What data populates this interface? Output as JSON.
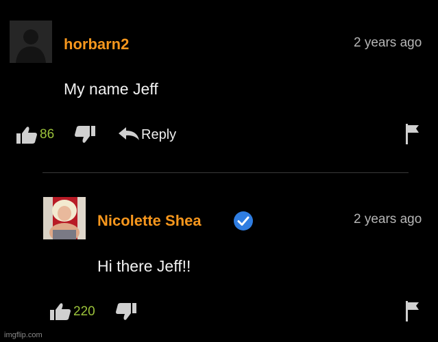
{
  "comments": [
    {
      "username": "horbarn2",
      "timestamp": "2 years ago",
      "text": "My name Jeff",
      "likes": "86",
      "reply_label": "Reply"
    },
    {
      "username": "Nicolette Shea",
      "verified": true,
      "timestamp": "2 years ago",
      "text": "Hi there Jeff!!",
      "likes": "220"
    }
  ],
  "watermark": "imgflip.com",
  "colors": {
    "background": "#000000",
    "username": "#f7971d",
    "likes": "#9cc33b",
    "timestamp": "#b7b7b7",
    "verified_badge": "#2f7de1"
  },
  "icons": [
    "default-avatar-icon",
    "thumbs-up-icon",
    "thumbs-down-icon",
    "reply-arrow-icon",
    "flag-icon",
    "verified-badge-icon"
  ]
}
